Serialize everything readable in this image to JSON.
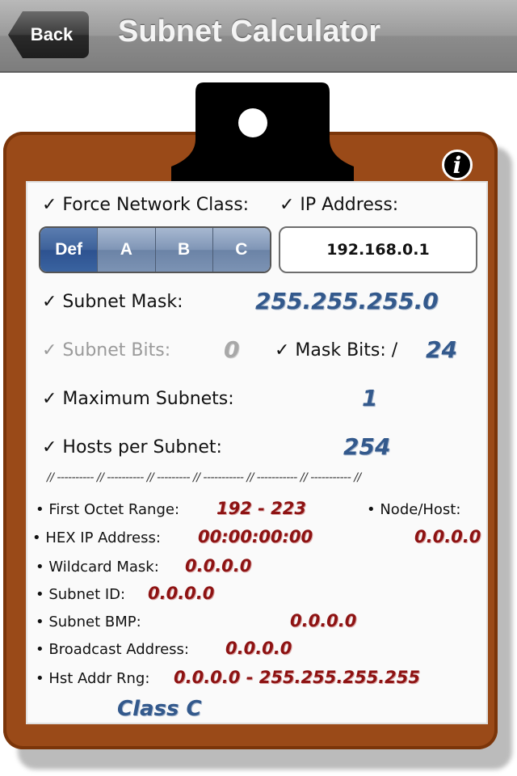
{
  "nav": {
    "back_label": "Back",
    "title": "Subnet Calculator"
  },
  "info_glyph": "i",
  "labels": {
    "force_class": "✓ Force Network Class:",
    "ip_address": "✓ IP Address:",
    "subnet_mask": "✓ Subnet Mask:",
    "subnet_bits": "✓ Subnet Bits:",
    "mask_bits": "✓ Mask Bits: /",
    "max_subnets": "✓ Maximum Subnets:",
    "hosts_per_subnet": "✓ Hosts per Subnet:"
  },
  "class_segments": [
    "Def",
    "A",
    "B",
    "C"
  ],
  "selected_segment": "Def",
  "ip_value": "192.168.0.1",
  "values": {
    "subnet_mask": "255.255.255.0",
    "subnet_bits": "0",
    "mask_bits": "24",
    "max_subnets": "1",
    "hosts_per_subnet": "254"
  },
  "divider": "// ---------- // ---------- // --------- // ----------- //  ----------- //  ----------- //",
  "details": {
    "first_octet_label": "• First Octet Range:",
    "first_octet_value": "192 - 223",
    "node_host_label": "• Node/Host:",
    "node_host_value": "0.0.0.0",
    "hex_ip_label": "• HEX IP Address:",
    "hex_ip_value": "00:00:00:00",
    "wildcard_label": "• Wildcard Mask:",
    "wildcard_value": "0.0.0.0",
    "subnet_id_label": "• Subnet ID:",
    "subnet_id_value": "0.0.0.0",
    "subnet_bmp_label": "• Subnet BMP:",
    "subnet_bmp_value": "0.0.0.0",
    "broadcast_label": "• Broadcast Address:",
    "broadcast_value": "0.0.0.0",
    "host_range_label": "• Hst Addr Rng:",
    "host_range_value": "0.0.0.0 - 255.255.255.255"
  },
  "class_result": "Class C",
  "colors": {
    "navbar": "#9a9a9a",
    "board": "#9a4a18",
    "segment_selected": "#3d619a",
    "handwriting_blue": "#33598c",
    "handwriting_red": "#8d1212"
  }
}
